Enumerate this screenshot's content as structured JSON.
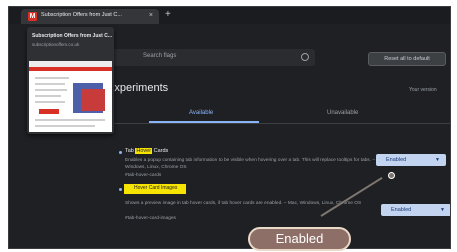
{
  "browser": {
    "tab_title": "Subscription Offers from Just C...",
    "tab_close": "×",
    "new_tab": "+"
  },
  "popup": {
    "title": "Subscription Offers from Just C...",
    "url": "subscriptionoffers.co.uk"
  },
  "search": {
    "placeholder": "Search flags"
  },
  "toolbar": {
    "reset_label": "Reset all to default"
  },
  "page": {
    "title": "Experiments",
    "version": "Your version"
  },
  "tabs": [
    {
      "label": "Available"
    },
    {
      "label": "Unavailable"
    }
  ],
  "flags": [
    {
      "title_prefix": "Tab ",
      "title_highlight": "Hover",
      "title_suffix": " Cards",
      "description": "Enables a popup containing tab information to be visible when hovering over a tab. This will replace tooltips for tabs. – Mac, Windows, Linux, Chrome OS",
      "link": "#tab-hover-cards",
      "status": "Enabled"
    },
    {
      "title": "Hover Card Images",
      "description": "Shows a preview image in tab hover cards, if tab hover cards are enabled. – Mac, Windows, Linux, Chrome OS",
      "link": "#tab-hover-card-images",
      "status": "Enabled"
    }
  ],
  "annotation": {
    "label": "Enabled"
  },
  "colors": {
    "background": "#1f2023",
    "accent": "#8ab4f8",
    "highlight": "#f6e400",
    "callout": "#8e6f68"
  }
}
